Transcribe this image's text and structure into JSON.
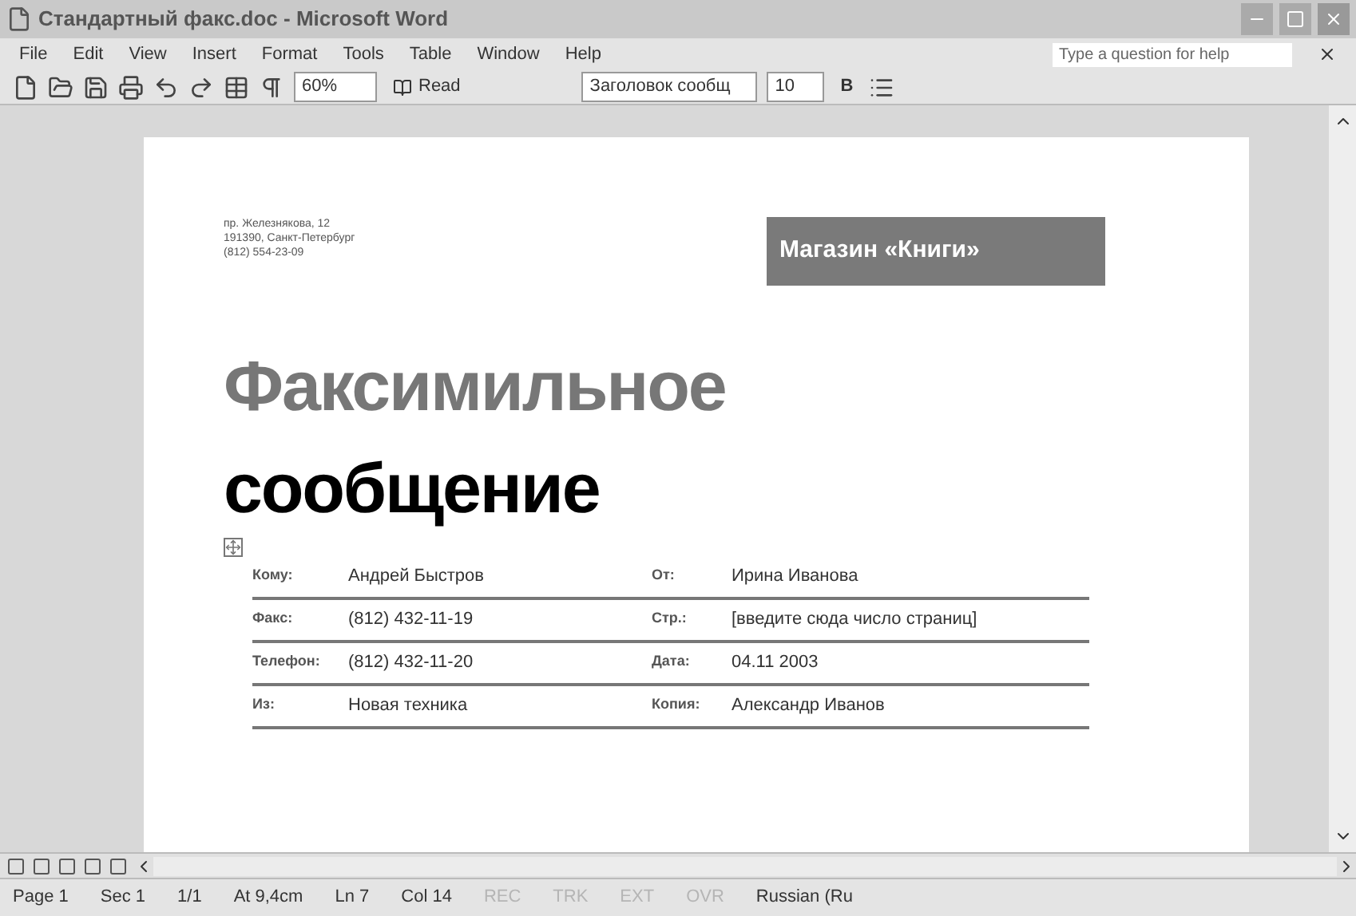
{
  "window": {
    "title": "Стандартный факс.doc - Microsoft Word"
  },
  "menu": [
    "File",
    "Edit",
    "View",
    "Insert",
    "Format",
    "Tools",
    "Table",
    "Window",
    "Help"
  ],
  "help_box": {
    "placeholder": "Type a question for help"
  },
  "toolbar": {
    "zoom": "60%",
    "read": "Read",
    "style": "Заголовок сообщ",
    "size": "10",
    "bold": "B"
  },
  "document": {
    "address": [
      "пр. Железнякова, 12",
      "191390, Санкт-Петербург",
      "(812) 554-23-09"
    ],
    "company": "Магазин «Книги»",
    "title_1": "Факсимильное",
    "title_2": "сообщение",
    "rows": [
      {
        "left_label": "Кому:",
        "left_value": "Андрей Быстров",
        "right_label": "От:",
        "right_value": "Ирина Иванова"
      },
      {
        "left_label": "Факс:",
        "left_value": "(812) 432-11-19",
        "right_label": "Стр.:",
        "right_value": "[введите сюда число страниц]"
      },
      {
        "left_label": "Телефон:",
        "left_value": "(812) 432-11-20",
        "right_label": "Дата:",
        "right_value": "04.11 2003"
      },
      {
        "left_label": "Из:",
        "left_value": "Новая техника",
        "right_label": "Копия:",
        "right_value": "Александр Иванов"
      }
    ]
  },
  "status_bar": [
    {
      "text": "Page 1",
      "disabled": false
    },
    {
      "text": "Sec 1",
      "disabled": false
    },
    {
      "text": "1/1",
      "disabled": false
    },
    {
      "text": "At 9,4cm",
      "disabled": false
    },
    {
      "text": "Ln 7",
      "disabled": false
    },
    {
      "text": "Col 14",
      "disabled": false
    },
    {
      "text": "REC",
      "disabled": true
    },
    {
      "text": "TRK",
      "disabled": true
    },
    {
      "text": "EXT",
      "disabled": true
    },
    {
      "text": "OVR",
      "disabled": true
    },
    {
      "text": "Russian (Ru",
      "disabled": false
    }
  ]
}
